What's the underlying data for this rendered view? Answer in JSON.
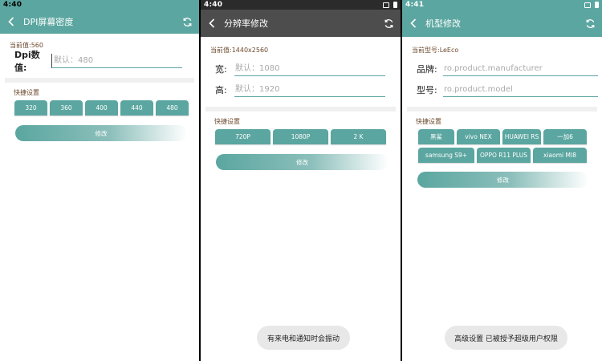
{
  "screen1": {
    "time": "4:40",
    "title": "DPI屏幕密度",
    "current": "当前值:560",
    "field_label": "Dpi数值:",
    "field_placeholder": "默认：480",
    "quick_title": "快捷设置",
    "chips": [
      "320",
      "360",
      "400",
      "440",
      "480"
    ],
    "modify_label": "修改"
  },
  "screen2": {
    "time": "4:40",
    "title": "分辨率修改",
    "current": "当前值:1440x2560",
    "width_label": "宽:",
    "width_placeholder": "默认：1080",
    "height_label": "高:",
    "height_placeholder": "默认：1920",
    "quick_title": "快捷设置",
    "chips": [
      "720P",
      "1080P",
      "2 K"
    ],
    "modify_label": "修改",
    "toast": "有来电和通知时会振动"
  },
  "screen3": {
    "time": "4:41",
    "title": "机型修改",
    "current": "当前型号:LeEco",
    "brand_label": "品牌:",
    "brand_placeholder": "ro.product.manufacturer",
    "model_label": "型号:",
    "model_placeholder": "ro.product.model",
    "quick_title": "快捷设置",
    "chips": [
      "黑鲨",
      "vivo NEX",
      "HUAWEI RS",
      "一加6",
      "samsung S9+",
      "OPPO R11 PLUS",
      "xiaomi MI8"
    ],
    "modify_label": "修改",
    "toast": "高级设置 已被授予超级用户权限"
  },
  "colors": {
    "accent": "#5ba6a0",
    "dark_toolbar": "#4d4d4d",
    "label_brown": "#6d4b2e",
    "toast_bg": "#e8e8e8"
  },
  "icons": [
    "back-arrow-icon",
    "refresh-icon",
    "vibrate-icon",
    "battery-icon"
  ]
}
